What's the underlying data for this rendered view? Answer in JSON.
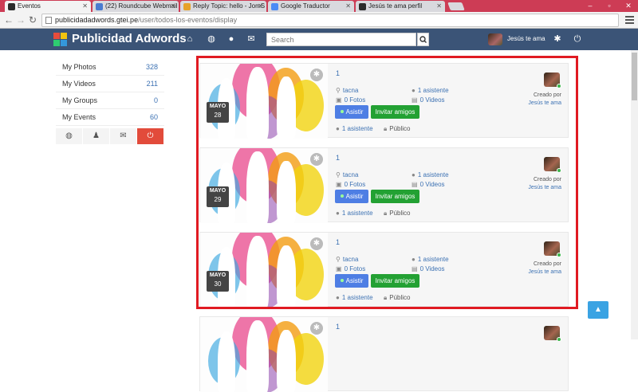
{
  "browser": {
    "tabs": [
      {
        "label": "Eventos",
        "fav_color": "#2b2b2b"
      },
      {
        "label": "(22) Roundcube Webmail",
        "fav_color": "#4a7bd0"
      },
      {
        "label": "Reply Topic: hello - JomS",
        "fav_color": "#e6a229"
      },
      {
        "label": "Google Traductor",
        "fav_color": "#4c8bf5"
      },
      {
        "label": "Jesús te ama perfil",
        "fav_color": "#2b2b2b"
      }
    ],
    "url_host": "publicidadadwords.gtei.pe",
    "url_path": "/user/todos-los-eventos/display"
  },
  "header": {
    "brand": "Publicidad Adwords",
    "search_placeholder": "Search",
    "username": "Jesús te ama"
  },
  "sidebar": {
    "items": [
      {
        "label": "My Photos",
        "count": "328"
      },
      {
        "label": "My Videos",
        "count": "211"
      },
      {
        "label": "My Groups",
        "count": "0"
      },
      {
        "label": "My Events",
        "count": "60"
      }
    ]
  },
  "events": [
    {
      "title": "1",
      "month": "MAYO",
      "day": "28",
      "location": "tacna",
      "attendees_top": "1 asistente",
      "photos": "0 Fotos",
      "videos": "0 Videos",
      "attend_label": "Asistir",
      "invite_label": "Invitar amigos",
      "attendees_bottom": "1 asistente",
      "privacy": "Público",
      "created_by_label": "Creado por",
      "creator": "Jesús te ama"
    },
    {
      "title": "1",
      "month": "MAYO",
      "day": "29",
      "location": "tacna",
      "attendees_top": "1 asistente",
      "photos": "0 Fotos",
      "videos": "0 Videos",
      "attend_label": "Asistir",
      "invite_label": "Invitar amigos",
      "attendees_bottom": "1 asistente",
      "privacy": "Público",
      "created_by_label": "Creado por",
      "creator": "Jesús te ama"
    },
    {
      "title": "1",
      "month": "MAYO",
      "day": "30",
      "location": "tacna",
      "attendees_top": "1 asistente",
      "photos": "0 Fotos",
      "videos": "0 Videos",
      "attend_label": "Asistir",
      "invite_label": "Invitar amigos",
      "attendees_bottom": "1 asistente",
      "privacy": "Público",
      "created_by_label": "Creado por",
      "creator": "Jesús te ama"
    },
    {
      "title": "1"
    }
  ],
  "colors": {
    "header_bg": "#3b5477",
    "link": "#3d72b3",
    "attend_btn": "#4e7ee4",
    "invite_btn": "#23a133",
    "highlight": "#e01a22"
  }
}
